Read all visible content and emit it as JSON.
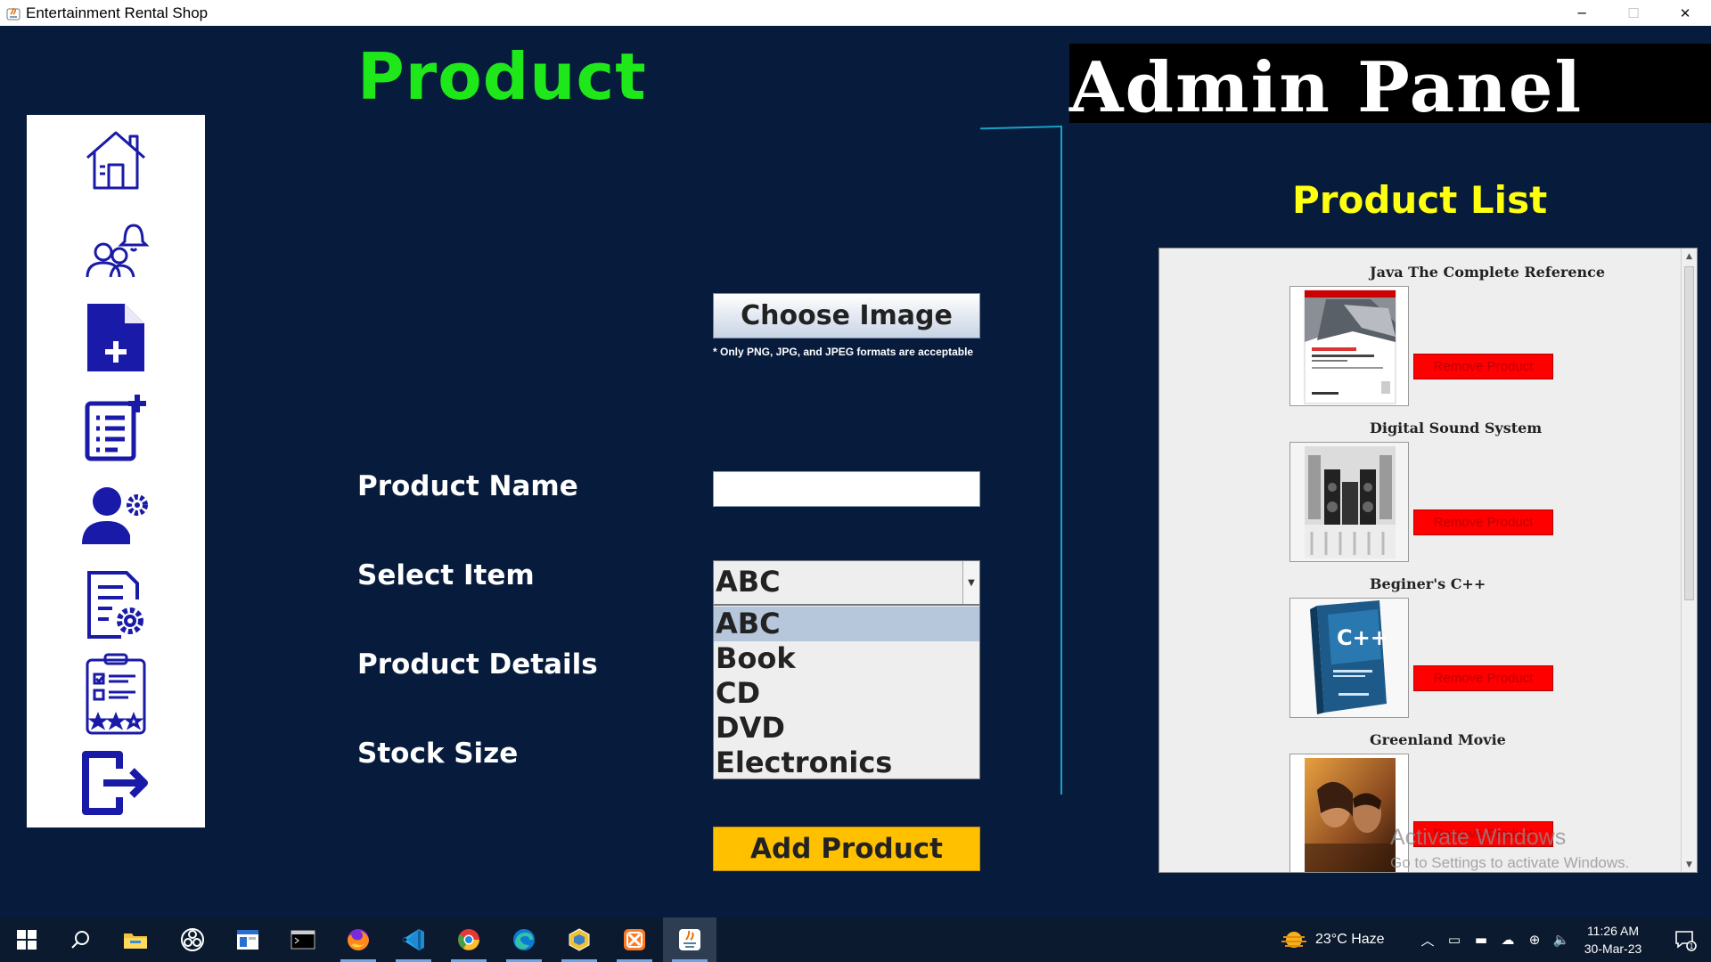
{
  "window": {
    "title": "Entertainment Rental Shop",
    "controls": {
      "minimize": "─",
      "maximize": "☐",
      "close": "✕"
    }
  },
  "sidebar": {
    "items": [
      {
        "icon": "home-icon"
      },
      {
        "icon": "customers-notification-icon"
      },
      {
        "icon": "add-document-icon"
      },
      {
        "icon": "add-list-icon"
      },
      {
        "icon": "user-settings-icon"
      },
      {
        "icon": "document-settings-icon"
      },
      {
        "icon": "clipboard-rating-icon"
      },
      {
        "icon": "logout-icon"
      }
    ]
  },
  "header": {
    "page_title": "Product",
    "admin_title": "Admin Panel"
  },
  "form": {
    "choose_image_label": "Choose Image",
    "image_note": "* Only PNG, JPG, and JPEG formats are acceptable",
    "product_name_label": "Product Name",
    "product_name_value": "",
    "select_item_label": "Select Item",
    "select_item_value": "ABC",
    "select_options": [
      "ABC",
      "Book",
      "CD",
      "DVD",
      "Electronics"
    ],
    "product_details_label": "Product Details",
    "stock_size_label": "Stock Size",
    "add_button_label": "Add Product"
  },
  "product_list": {
    "heading": "Product List",
    "remove_label": "Remove Product",
    "items": [
      {
        "name": "Java The Complete Reference"
      },
      {
        "name": "Digital Sound System"
      },
      {
        "name": "Beginer's C++"
      },
      {
        "name": "Greenland Movie"
      }
    ]
  },
  "watermark": {
    "line1": "Activate Windows",
    "line2": "Go to Settings to activate Windows."
  },
  "taskbar": {
    "weather": "23°C  Haze",
    "time": "11:26 AM",
    "date": "30-Mar-23",
    "notification_count": "1"
  },
  "colors": {
    "background": "#071c3c",
    "product_heading": "#1ee81a",
    "list_heading": "#ffff10",
    "add_button": "#ffc000",
    "remove_button": "#ff0000",
    "icon_blue": "#1a1aa8"
  }
}
